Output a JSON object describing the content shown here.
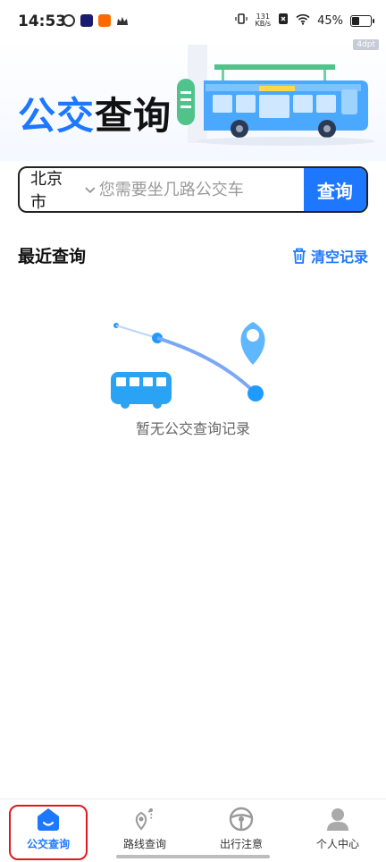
{
  "status_bar": {
    "time": "14:53",
    "net_speed_value": "131",
    "net_speed_unit": "KB/s",
    "battery_percent": "45%",
    "battery_level": 0.45
  },
  "hero": {
    "title_part1": "公交",
    "title_part2": "查询",
    "ad_label": "4dpt"
  },
  "search": {
    "city": "北京市",
    "placeholder": "您需要坐几路公交车",
    "button_label": "查询"
  },
  "recent": {
    "title": "最近查询",
    "clear_label": "清空记录",
    "empty_text": "暂无公交查询记录"
  },
  "bottom_nav": {
    "items": [
      {
        "label": "公交查询",
        "active": true
      },
      {
        "label": "路线查询",
        "active": false
      },
      {
        "label": "出行注意",
        "active": false
      },
      {
        "label": "个人中心",
        "active": false
      }
    ]
  },
  "colors": {
    "accent": "#1e78ff",
    "highlight": "#e0191e"
  }
}
